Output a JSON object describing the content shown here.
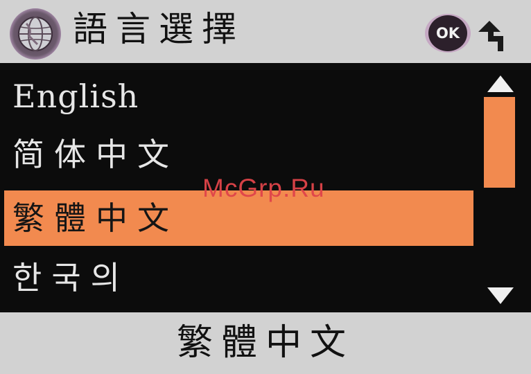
{
  "header": {
    "title": "語言選擇",
    "globe_icon": "globe-icon",
    "ok_label": "OK",
    "back_icon": "return-arrow-icon"
  },
  "language_list": {
    "items": [
      {
        "label": "English",
        "selected": false
      },
      {
        "label": "简体中文",
        "selected": false
      },
      {
        "label": "繁體中文",
        "selected": true
      },
      {
        "label": "한국의",
        "selected": false
      }
    ]
  },
  "scrollbar": {
    "up_icon": "triangle-up-icon",
    "down_icon": "triangle-down-icon"
  },
  "footer": {
    "current_selection": "繁體中文"
  },
  "watermark": "McGrp.Ru",
  "colors": {
    "bars": "#d2d2d2",
    "background": "#0c0c0c",
    "highlight": "#f28a4f",
    "text_light": "#e6e6e6",
    "watermark": "#e0444a"
  }
}
